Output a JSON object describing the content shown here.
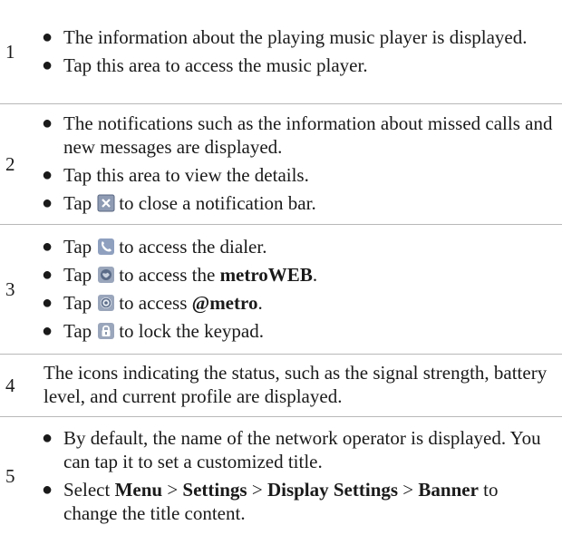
{
  "rows": [
    {
      "num": "1",
      "items": [
        "The information about the playing music player is displayed.",
        "Tap this area to access the music player."
      ]
    },
    {
      "num": "2",
      "items": [
        "The notifications such as the information about missed calls and new messages are displayed.",
        "Tap this area to view the details."
      ],
      "close_item": {
        "pre": "Tap",
        "post": "to close a notification bar.",
        "icon": "close-box-icon"
      }
    },
    {
      "num": "3",
      "items": [
        {
          "pre": "Tap",
          "post": "to access the dialer.",
          "icon": "phone-icon"
        },
        {
          "pre": "Tap",
          "post": "to access the ",
          "bold": "metroWEB",
          "tail": ".",
          "icon": "globe-icon"
        },
        {
          "pre": "Tap",
          "post": "to access ",
          "bold": "@metro",
          "tail": ".",
          "icon": "at-sign-icon"
        },
        {
          "pre": "Tap",
          "post": "to lock the keypad.",
          "icon": "lock-icon"
        }
      ]
    },
    {
      "num": "4",
      "text": "The icons indicating the status, such as the signal strength, battery level, and current profile are displayed."
    },
    {
      "num": "5",
      "items": [
        "By default, the name of the network operator is displayed. You can tap it to set a customized title."
      ],
      "path_item": {
        "pre": "Select ",
        "menu": "Menu",
        "sep": " > ",
        "settings": "Settings",
        "display": "Display Settings",
        "banner": "Banner",
        "post": " to change the title content."
      }
    }
  ],
  "bullet_char": "●",
  "colors": {
    "text": "#1a1a1a",
    "divider": "#b8b8b8",
    "icon_bg": "#9aa4b8"
  }
}
